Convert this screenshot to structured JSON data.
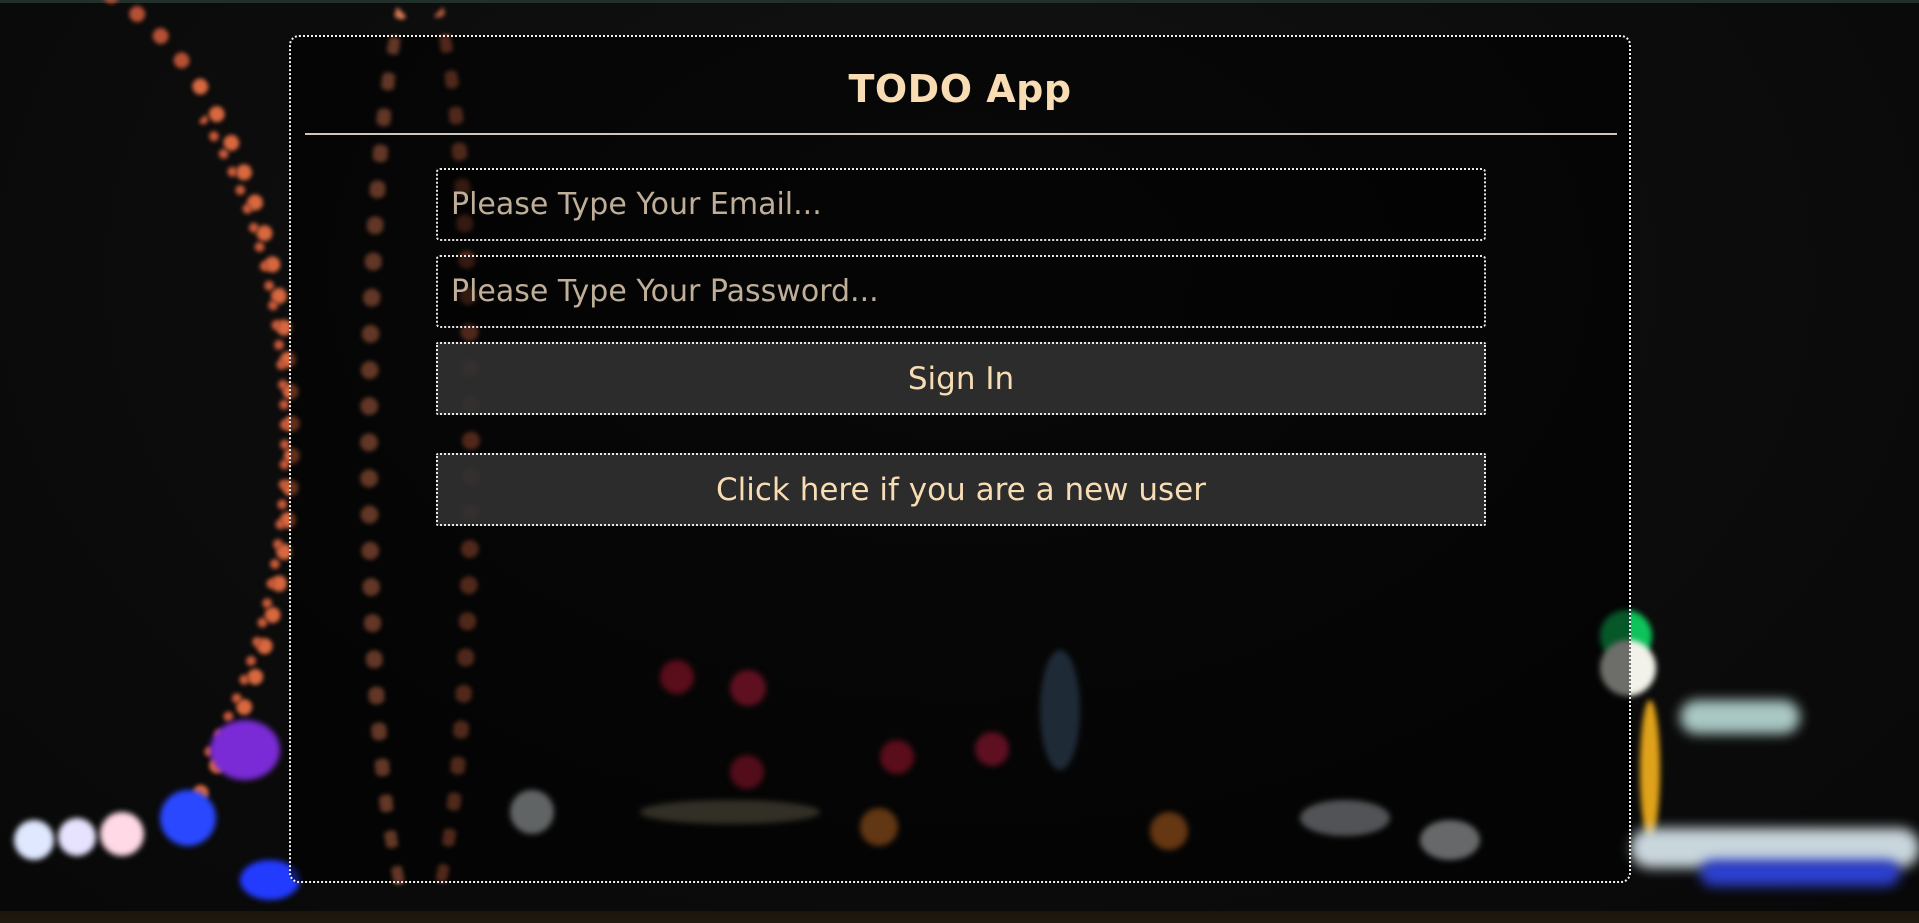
{
  "app": {
    "title": "TODO App"
  },
  "form": {
    "email_placeholder": "Please Type Your Email...",
    "email_value": "",
    "password_placeholder": "Please Type Your Password...",
    "password_value": "",
    "signin_label": "Sign In",
    "register_label": "Click here if you are a new user"
  },
  "colors": {
    "accent_text": "#f8dcb4",
    "placeholder_text": "#bfae98",
    "border": "#f2f2f2",
    "button_bg": "#303030"
  }
}
